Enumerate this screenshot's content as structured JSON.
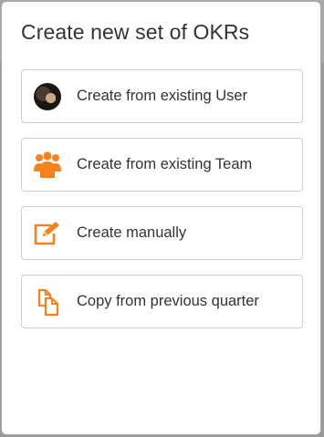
{
  "modal": {
    "title": "Create new set of OKRs"
  },
  "options": [
    {
      "label": "Create from existing User",
      "icon": "user-avatar-icon"
    },
    {
      "label": "Create from existing Team",
      "icon": "team-icon"
    },
    {
      "label": "Create manually",
      "icon": "edit-icon"
    },
    {
      "label": "Copy from previous quarter",
      "icon": "copy-icon"
    }
  ],
  "colors": {
    "accent": "#f7821b",
    "text": "#333333",
    "border": "#cfcfcf",
    "backdrop": "#9a9a9a"
  }
}
